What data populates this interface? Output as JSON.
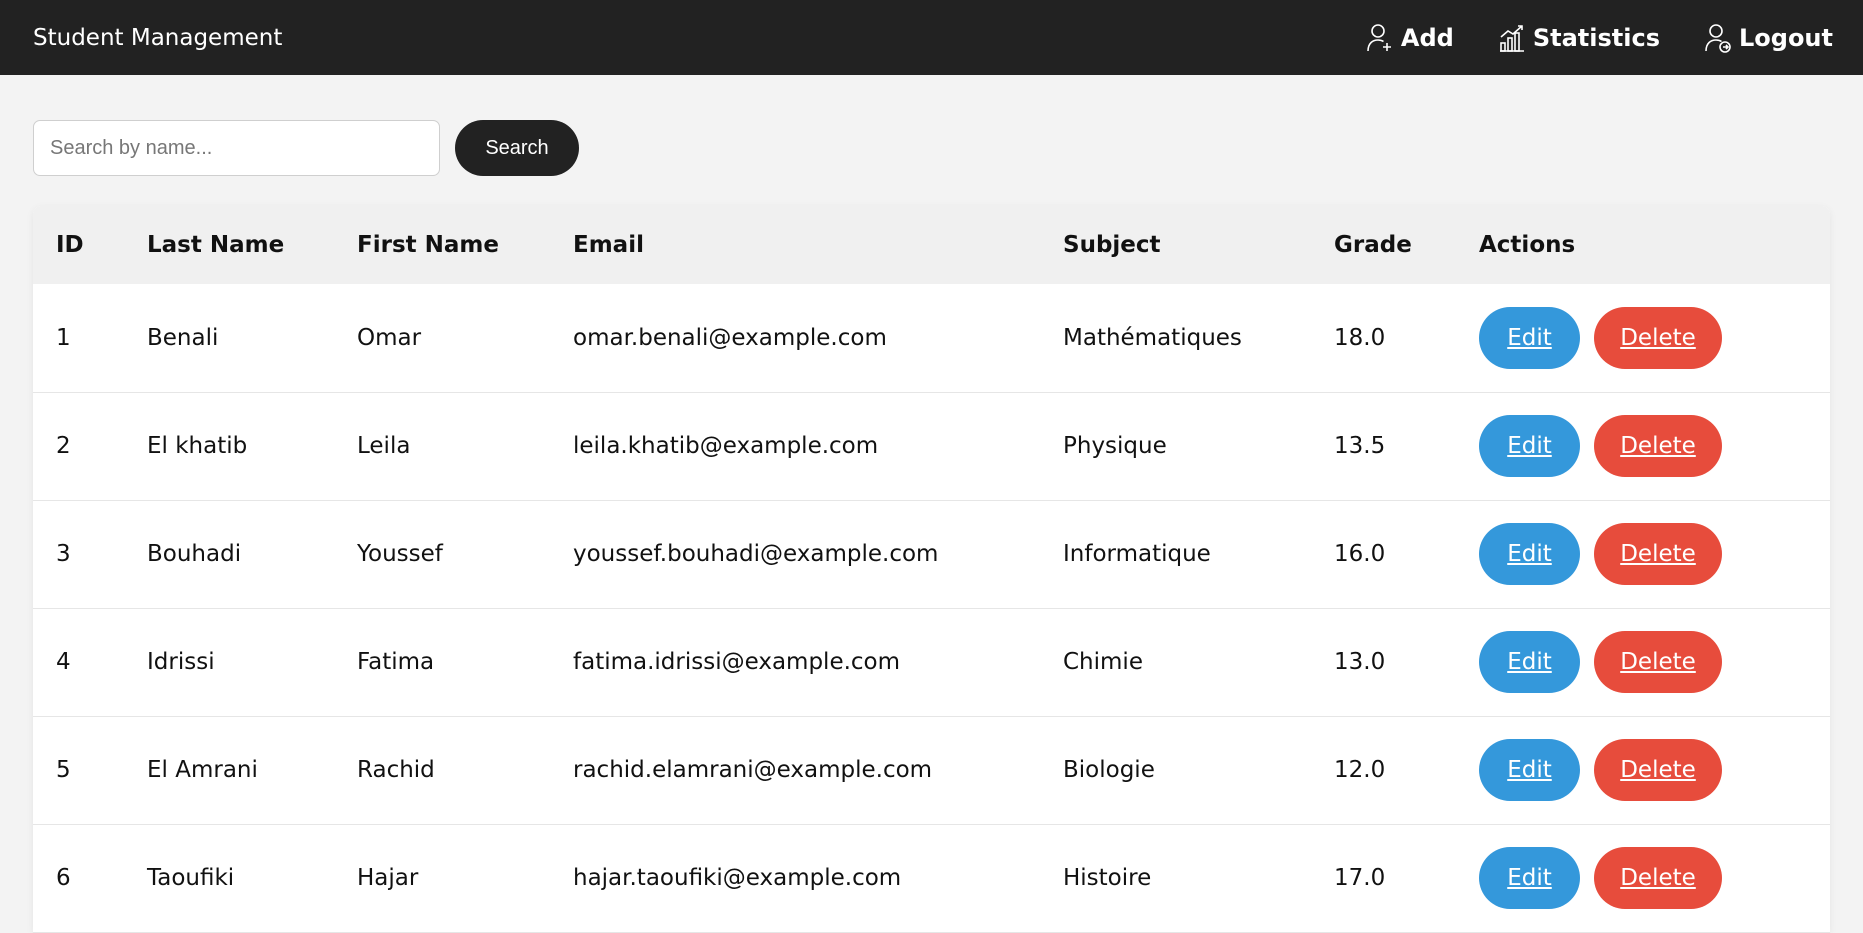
{
  "navbar": {
    "brand": "Student Management",
    "links": [
      {
        "label": "Add",
        "icon": "user-add-icon"
      },
      {
        "label": "Statistics",
        "icon": "bar-chart-icon"
      },
      {
        "label": "Logout",
        "icon": "user-logout-icon"
      }
    ]
  },
  "search": {
    "placeholder": "Search by name...",
    "button_label": "Search"
  },
  "table": {
    "headers": [
      "ID",
      "Last Name",
      "First Name",
      "Email",
      "Subject",
      "Grade",
      "Actions"
    ],
    "edit_label": "Edit",
    "delete_label": "Delete",
    "rows": [
      {
        "id": "1",
        "last_name": "Benali",
        "first_name": "Omar",
        "email": "omar.benali@example.com",
        "subject": "Mathématiques",
        "grade": "18.0"
      },
      {
        "id": "2",
        "last_name": "El khatib",
        "first_name": "Leila",
        "email": "leila.khatib@example.com",
        "subject": "Physique",
        "grade": "13.5"
      },
      {
        "id": "3",
        "last_name": "Bouhadi",
        "first_name": "Youssef",
        "email": "youssef.bouhadi@example.com",
        "subject": "Informatique",
        "grade": "16.0"
      },
      {
        "id": "4",
        "last_name": "Idrissi",
        "first_name": "Fatima",
        "email": "fatima.idrissi@example.com",
        "subject": "Chimie",
        "grade": "13.0"
      },
      {
        "id": "5",
        "last_name": "El Amrani",
        "first_name": "Rachid",
        "email": "rachid.elamrani@example.com",
        "subject": "Biologie",
        "grade": "12.0"
      },
      {
        "id": "6",
        "last_name": "Taoufiki",
        "first_name": "Hajar",
        "email": "hajar.taoufiki@example.com",
        "subject": "Histoire",
        "grade": "17.0"
      }
    ]
  },
  "colors": {
    "navbar_bg": "#222222",
    "edit_button": "#3498db",
    "delete_button": "#e74c3c",
    "page_bg": "#f3f3f3"
  }
}
